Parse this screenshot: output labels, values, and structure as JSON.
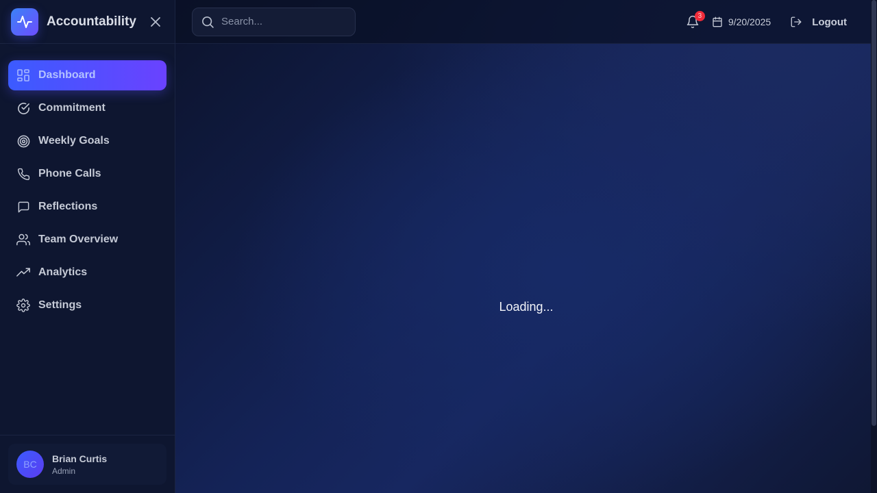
{
  "brand": {
    "name": "Accountability"
  },
  "sidebar": {
    "items": [
      {
        "label": "Dashboard",
        "icon": "dashboard-grid-icon",
        "active": true
      },
      {
        "label": "Commitment",
        "icon": "check-circle-icon"
      },
      {
        "label": "Weekly Goals",
        "icon": "target-icon"
      },
      {
        "label": "Phone Calls",
        "icon": "phone-icon"
      },
      {
        "label": "Reflections",
        "icon": "chat-bubble-icon"
      },
      {
        "label": "Team Overview",
        "icon": "users-icon"
      },
      {
        "label": "Analytics",
        "icon": "trending-up-icon"
      },
      {
        "label": "Settings",
        "icon": "gear-icon"
      }
    ]
  },
  "user": {
    "initials": "BC",
    "name": "Brian Curtis",
    "role": "Admin"
  },
  "topbar": {
    "search_placeholder": "Search...",
    "notifications_count": "3",
    "date": "9/20/2025",
    "logout_label": "Logout"
  },
  "main": {
    "status": "Loading..."
  },
  "colors": {
    "accent_start": "#3b5bff",
    "accent_end": "#6a42ff",
    "badge": "#ef2b3a",
    "background": "#0b1226"
  }
}
